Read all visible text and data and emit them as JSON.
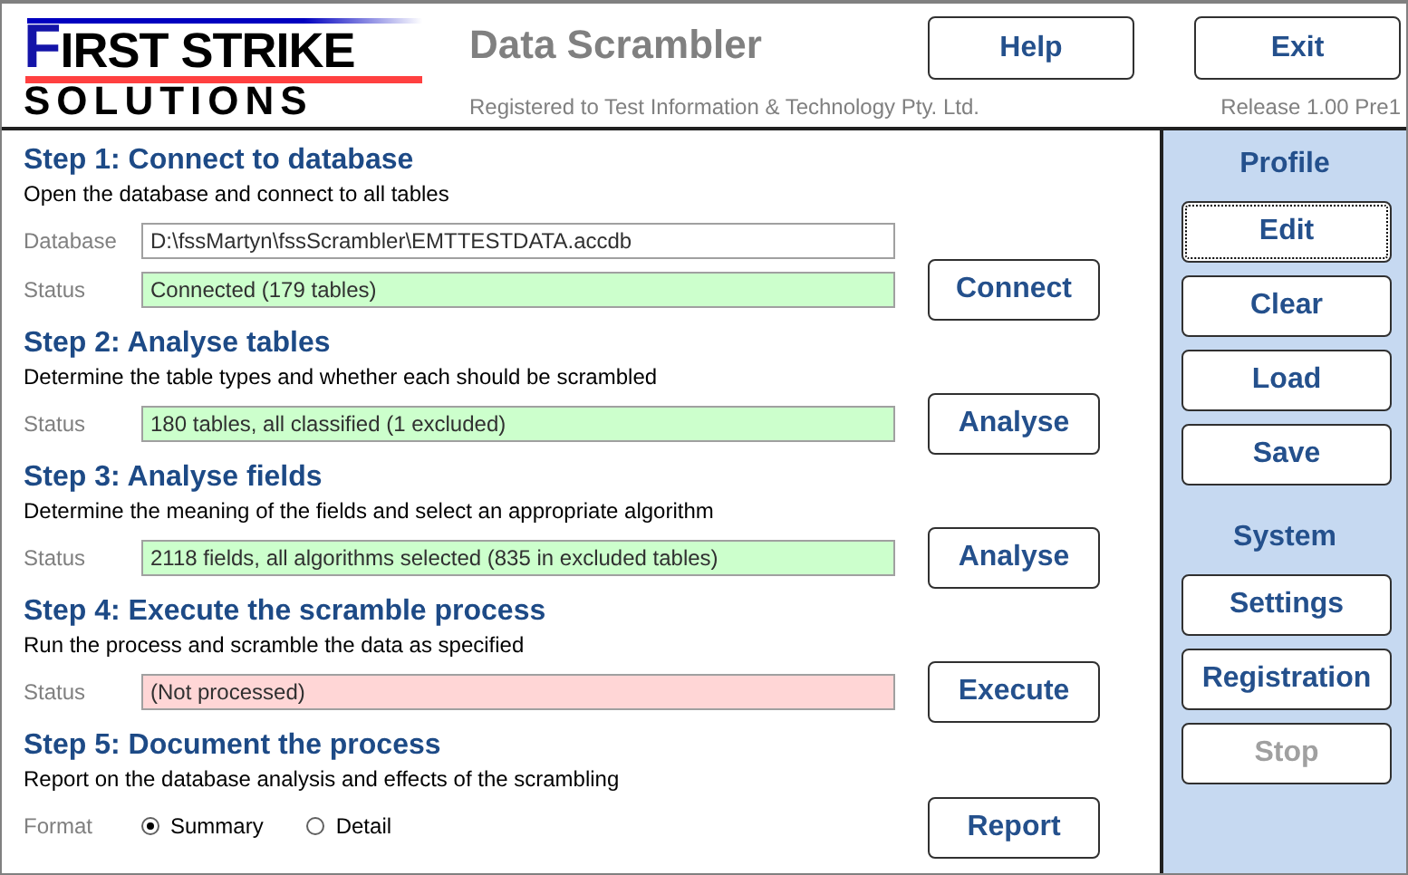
{
  "logo": {
    "line_1": "FIRST STRIKE",
    "line_2": "SOLUTIONS"
  },
  "app": {
    "title": "Data Scrambler",
    "registration": "Registered to Test Information & Technology Pty. Ltd.",
    "release": "Release 1.00 Pre1"
  },
  "header_buttons": [
    {
      "label": "Help"
    },
    {
      "label": "Exit"
    }
  ],
  "steps": [
    {
      "title": "Step 1: Connect to database",
      "description": "Open the database and connect to all tables",
      "rows": [
        {
          "kind": "field",
          "label": "Database",
          "value": "D:\\fssMartyn\\fssScrambler\\EMTTESTDATA.accdb",
          "color": "#ffffff"
        },
        {
          "kind": "field",
          "label": "Status",
          "value": "Connected (179 tables)",
          "color": "#ccffcc"
        }
      ],
      "button": "Connect"
    },
    {
      "title": "Step 2: Analyse tables",
      "description": "Determine the table types and whether each should be scrambled",
      "rows": [
        {
          "kind": "field",
          "label": "Status",
          "value": "180 tables, all classified (1 excluded)",
          "color": "#ccffcc"
        }
      ],
      "button": "Analyse"
    },
    {
      "title": "Step 3: Analyse fields",
      "description": "Determine the meaning of the fields and select an appropriate algorithm",
      "rows": [
        {
          "kind": "field",
          "label": "Status",
          "value": "2118 fields, all algorithms selected (835 in excluded tables)",
          "color": "#ccffcc"
        }
      ],
      "button": "Analyse"
    },
    {
      "title": "Step 4: Execute the scramble process",
      "description": "Run the process and scramble the data as specified",
      "rows": [
        {
          "kind": "field",
          "label": "Status",
          "value": "(Not processed)",
          "color": "#ffd6d6"
        }
      ],
      "button": "Execute"
    },
    {
      "title": "Step 5: Document the process",
      "description": "Report on the database analysis and effects of the scrambling",
      "rows": [
        {
          "kind": "radios",
          "label": "Format",
          "options": [
            {
              "label": "Summary",
              "selected": true
            },
            {
              "label": "Detail",
              "selected": false
            }
          ]
        }
      ],
      "button": "Report"
    }
  ],
  "sidebar": [
    {
      "heading": "Profile",
      "buttons": [
        {
          "label": "Edit",
          "focused": true,
          "disabled": false
        },
        {
          "label": "Clear",
          "focused": false,
          "disabled": false
        },
        {
          "label": "Load",
          "focused": false,
          "disabled": false
        },
        {
          "label": "Save",
          "focused": false,
          "disabled": false
        }
      ]
    },
    {
      "heading": "System",
      "buttons": [
        {
          "label": "Settings",
          "focused": false,
          "disabled": false
        },
        {
          "label": "Registration",
          "focused": false,
          "disabled": false
        },
        {
          "label": "Stop",
          "focused": false,
          "disabled": true
        }
      ]
    }
  ]
}
